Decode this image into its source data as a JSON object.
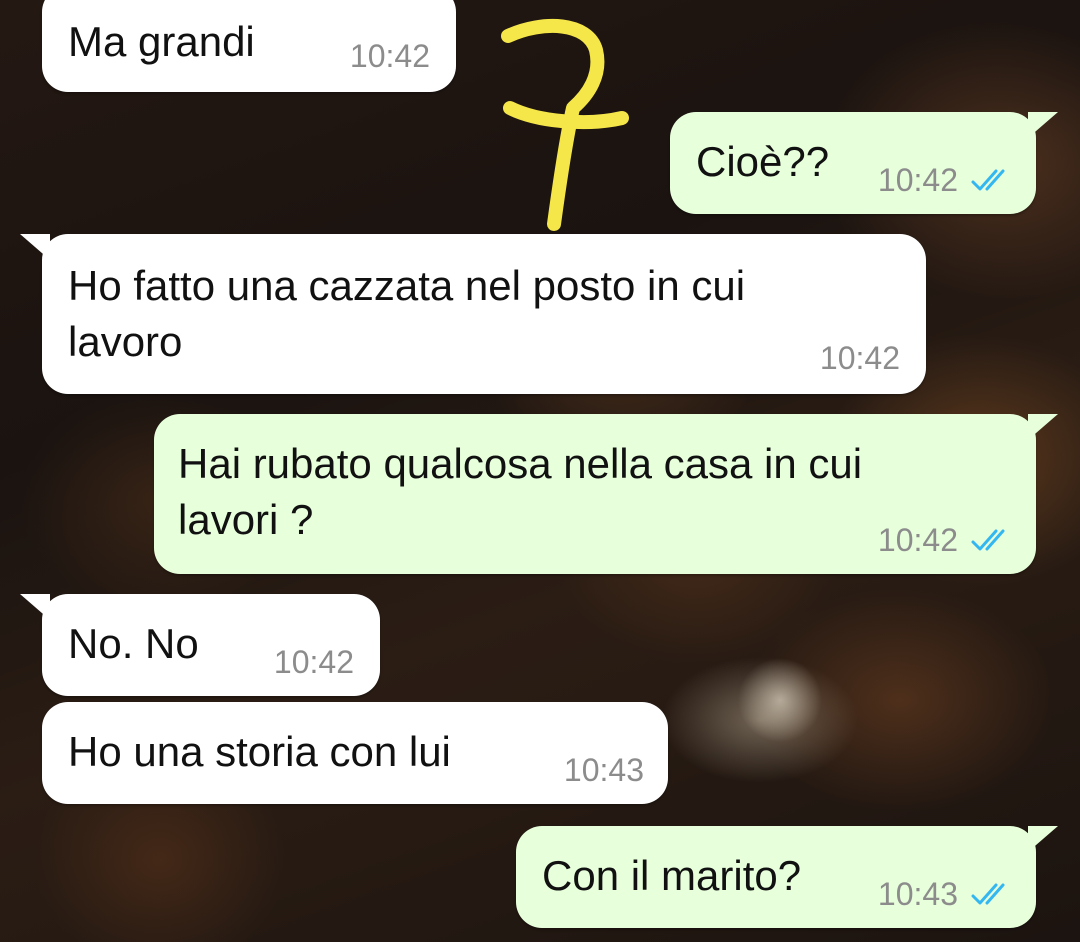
{
  "messages": [
    {
      "id": "m1",
      "direction": "in",
      "text": "Ma grandi",
      "time": "10:42"
    },
    {
      "id": "m2",
      "direction": "out",
      "text": "Cioè??",
      "time": "10:42",
      "status_icon": "double-check-read-icon"
    },
    {
      "id": "m3",
      "direction": "in",
      "text": "Ho fatto una cazzata nel posto in cui\nlavoro",
      "time": "10:42"
    },
    {
      "id": "m4",
      "direction": "out",
      "text": "Hai rubato qualcosa nella casa in cui\nlavori ?",
      "time": "10:42",
      "status_icon": "double-check-read-icon"
    },
    {
      "id": "m5",
      "direction": "in",
      "text": "No. No",
      "time": "10:42"
    },
    {
      "id": "m6",
      "direction": "in",
      "text": "Ho una storia con lui",
      "time": "10:43"
    },
    {
      "id": "m7",
      "direction": "out",
      "text": "Con il marito?",
      "time": "10:43",
      "status_icon": "double-check-read-icon"
    }
  ],
  "colors": {
    "incoming_bubble": "#ffffff",
    "outgoing_bubble": "#e7ffdb",
    "read_ticks": "#34b7f1",
    "timestamp": "#8c8c8c",
    "annotation": "#f5e64a"
  },
  "annotation": {
    "icon": "yellow-marker-scribble"
  }
}
